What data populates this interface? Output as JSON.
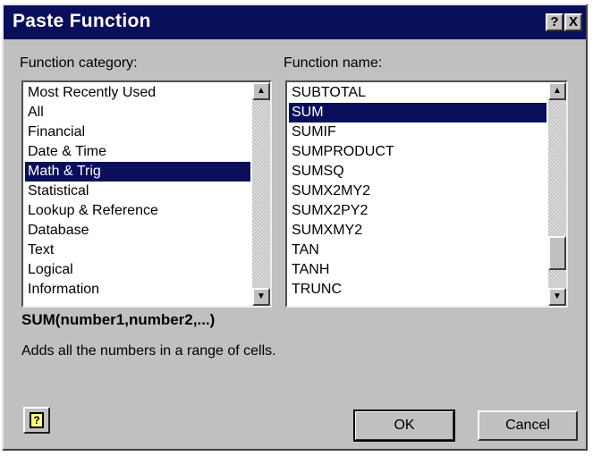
{
  "window": {
    "title": "Paste Function",
    "help_button": "?",
    "close_button": "X"
  },
  "category": {
    "label": "Function category:",
    "selected": "Math & Trig",
    "items": [
      {
        "label": "Most Recently Used"
      },
      {
        "label": "All"
      },
      {
        "label": "Financial"
      },
      {
        "label": "Date & Time"
      },
      {
        "label": "Math & Trig"
      },
      {
        "label": "Statistical"
      },
      {
        "label": "Lookup & Reference"
      },
      {
        "label": "Database"
      },
      {
        "label": "Text"
      },
      {
        "label": "Logical"
      },
      {
        "label": "Information"
      }
    ]
  },
  "function_name": {
    "label": "Function name:",
    "selected": "SUM",
    "items": [
      {
        "label": "SUBTOTAL"
      },
      {
        "label": "SUM"
      },
      {
        "label": "SUMIF"
      },
      {
        "label": "SUMPRODUCT"
      },
      {
        "label": "SUMSQ"
      },
      {
        "label": "SUMX2MY2"
      },
      {
        "label": "SUMX2PY2"
      },
      {
        "label": "SUMXMY2"
      },
      {
        "label": "TAN"
      },
      {
        "label": "TANH"
      },
      {
        "label": "TRUNC"
      }
    ]
  },
  "syntax": "SUM(number1,number2,...)",
  "description": "Adds all the numbers in a range of cells.",
  "buttons": {
    "ok": "OK",
    "cancel": "Cancel",
    "help_icon": "?"
  },
  "icons": {
    "scroll_up": "▲",
    "scroll_down": "▼"
  },
  "colors": {
    "title_bar": "#0a0f5c",
    "selection": "#0a0f5c",
    "dialog_face": "#c0c0c0"
  }
}
